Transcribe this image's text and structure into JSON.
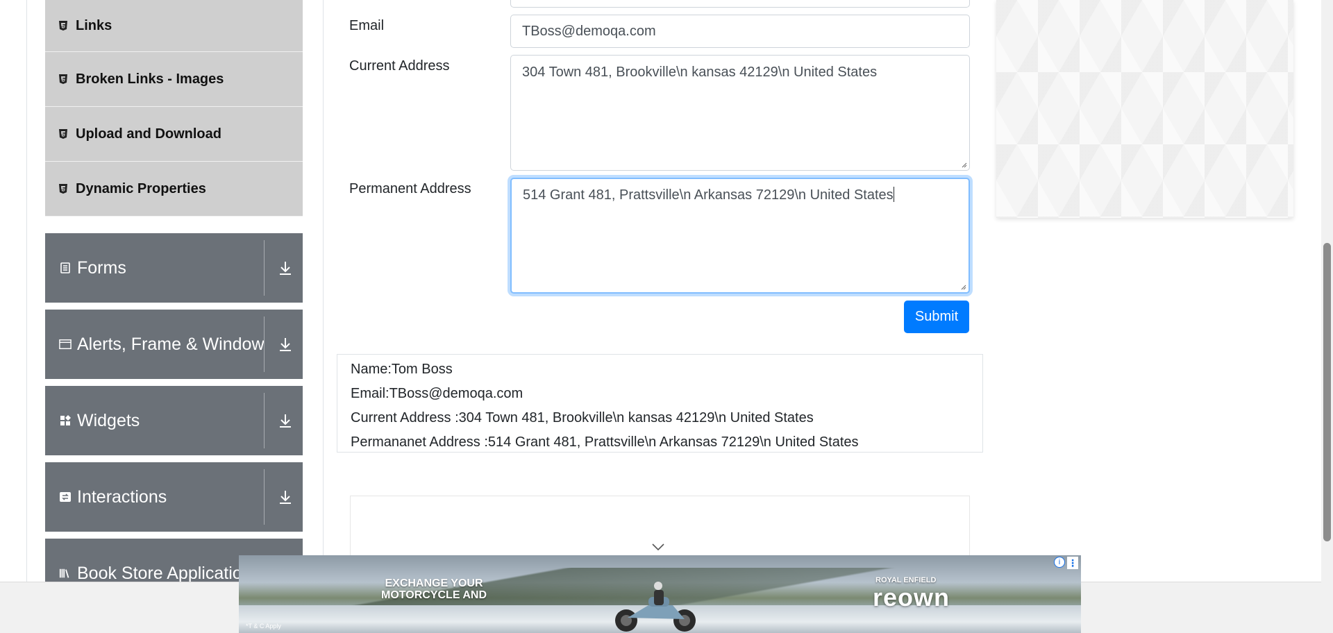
{
  "sidebar": {
    "element_items": [
      {
        "label": "Links"
      },
      {
        "label": "Broken Links - Images"
      },
      {
        "label": "Upload and Download"
      },
      {
        "label": "Dynamic Properties"
      }
    ],
    "groups": [
      {
        "label": "Forms",
        "icon": "document-icon"
      },
      {
        "label": "Alerts, Frame & Windows",
        "icon": "window-icon"
      },
      {
        "label": "Widgets",
        "icon": "widgets-icon"
      },
      {
        "label": "Interactions",
        "icon": "interactions-icon"
      },
      {
        "label": "Book Store Application",
        "icon": "books-icon"
      }
    ]
  },
  "form": {
    "email_label": "Email",
    "email_value": "TBoss@demoqa.com",
    "current_address_label": "Current Address",
    "current_address_value": "304 Town 481, Brookville\\n kansas 42129\\n United States",
    "permanent_address_label": "Permanent Address",
    "permanent_address_value": "514 Grant 481, Prattsville\\n Arkansas 72129\\n United States",
    "submit_label": "Submit"
  },
  "output": {
    "name": "Name:Tom Boss",
    "email": "Email:TBoss@demoqa.com",
    "current_address": "Current Address :304 Town 481, Brookville\\n kansas 42129\\n United States",
    "permanent_address": "Permananet Address :514 Grant 481, Prattsville\\n Arkansas 72129\\n United States"
  },
  "ad": {
    "headline": "EXCHANGE YOUR\nMOTORCYCLE AND",
    "brand_top": "ROYAL ENFIELD",
    "brand_main": "reown",
    "terms": "*T & C Apply"
  },
  "colors": {
    "accent": "#007bff",
    "group_bg": "#6b7178",
    "item_bg": "#cfcfcf"
  }
}
